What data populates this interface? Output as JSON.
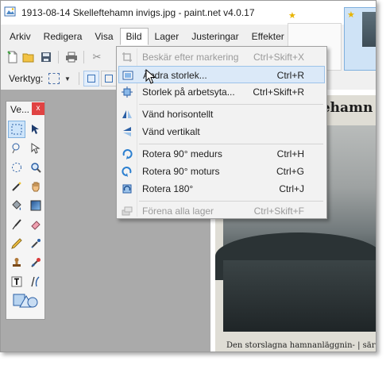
{
  "window": {
    "title": "1913-08-14 Skelleftehamn invigs.jpg - paint.net v4.0.17"
  },
  "menubar": {
    "items": [
      "Arkiv",
      "Redigera",
      "Visa",
      "Bild",
      "Lager",
      "Justeringar",
      "Effekter"
    ],
    "open_item": "Bild"
  },
  "toolbar": {
    "tool_label": "Verktyg:"
  },
  "tools_panel": {
    "title": "Ve...",
    "close_label": "x"
  },
  "dropdown": {
    "items": [
      {
        "label": "Beskär efter markering",
        "shortcut": "Ctrl+Skift+X",
        "disabled": true,
        "icon": "crop-icon"
      },
      {
        "label": "Ändra storlek...",
        "shortcut": "Ctrl+R",
        "highlighted": true,
        "icon": "resize-icon"
      },
      {
        "label": "Storlek på arbetsyta...",
        "shortcut": "Ctrl+Skift+R",
        "icon": "canvas-size-icon"
      },
      {
        "label": "Vänd horisontellt",
        "shortcut": "",
        "icon": "flip-horizontal-icon"
      },
      {
        "label": "Vänd vertikalt",
        "shortcut": "",
        "icon": "flip-vertical-icon"
      },
      {
        "label": "Rotera 90° medurs",
        "shortcut": "Ctrl+H",
        "icon": "rotate-cw-icon"
      },
      {
        "label": "Rotera 90° moturs",
        "shortcut": "Ctrl+G",
        "icon": "rotate-ccw-icon"
      },
      {
        "label": "Rotera 180°",
        "shortcut": "Ctrl+J",
        "icon": "rotate-180-icon"
      },
      {
        "label": "Förena alla lager",
        "shortcut": "Ctrl+Skift+F",
        "disabled": true,
        "icon": "flatten-icon"
      }
    ]
  },
  "canvas": {
    "headline": "Skelleftehamn",
    "caption": "Den storslagna hamnanläggnin- | sär"
  },
  "colors": {
    "accent": "#3a72b8",
    "highlight": "#dbe9f8",
    "close_red": "#e04343",
    "star": "#e8b400"
  }
}
